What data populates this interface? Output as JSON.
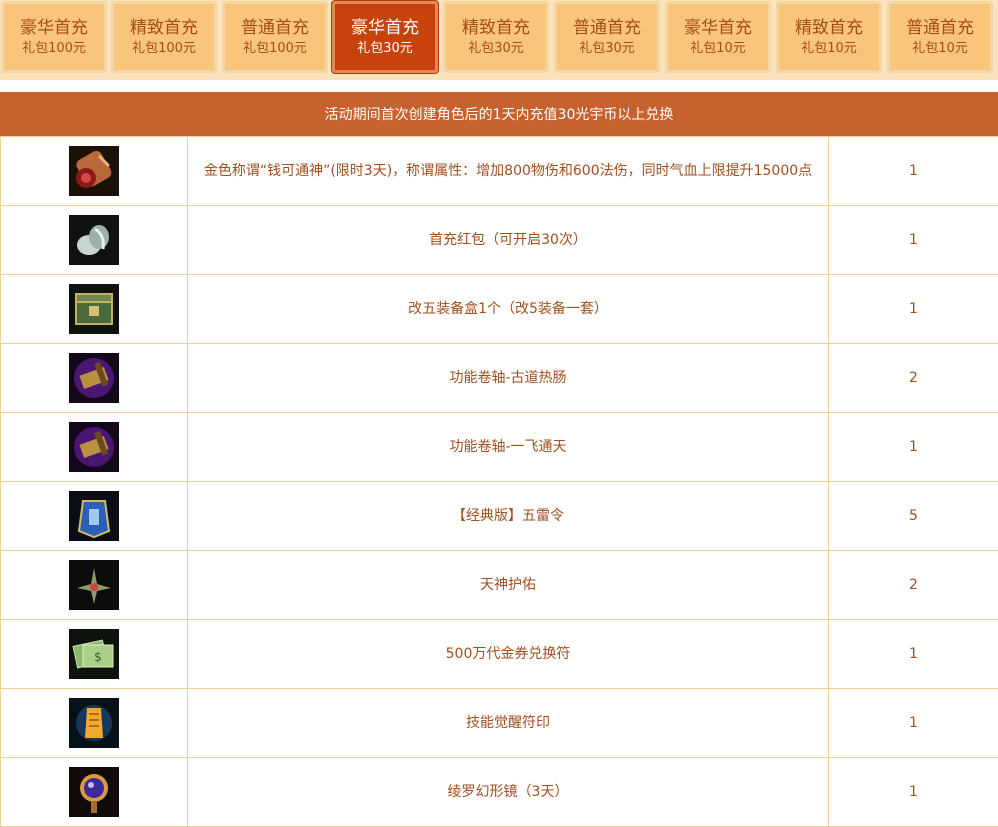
{
  "tabs": [
    {
      "title": "豪华首充",
      "sub": "礼包100元",
      "active": false
    },
    {
      "title": "精致首充",
      "sub": "礼包100元",
      "active": false
    },
    {
      "title": "普通首充",
      "sub": "礼包100元",
      "active": false
    },
    {
      "title": "豪华首充",
      "sub": "礼包30元",
      "active": true
    },
    {
      "title": "精致首充",
      "sub": "礼包30元",
      "active": false
    },
    {
      "title": "普通首充",
      "sub": "礼包30元",
      "active": false
    },
    {
      "title": "豪华首充",
      "sub": "礼包10元",
      "active": false
    },
    {
      "title": "精致首充",
      "sub": "礼包10元",
      "active": false
    },
    {
      "title": "普通首充",
      "sub": "礼包10元",
      "active": false
    }
  ],
  "notice": "活动期间首次创建角色后的1天内充值30光宇币以上兑换",
  "items": [
    {
      "icon": "scroll-title-icon",
      "name": "金色称谓“钱可通神”(限时3天)，称谓属性：增加800物伤和600法伤，同时气血上限提升15000点",
      "qty": "1"
    },
    {
      "icon": "red-envelope-icon",
      "name": "首充红包（可开启30次）",
      "qty": "1"
    },
    {
      "icon": "equipment-box-icon",
      "name": "改五装备盒1个（改5装备一套）",
      "qty": "1"
    },
    {
      "icon": "function-scroll-icon",
      "name": "功能卷轴-古道热肠",
      "qty": "2"
    },
    {
      "icon": "function-scroll-icon",
      "name": "功能卷轴-一飞通天",
      "qty": "1"
    },
    {
      "icon": "thunder-token-icon",
      "name": "【经典版】五雷令",
      "qty": "5"
    },
    {
      "icon": "divine-blessing-icon",
      "name": "天神护佑",
      "qty": "2"
    },
    {
      "icon": "cash-voucher-icon",
      "name": "500万代金券兑换符",
      "qty": "1"
    },
    {
      "icon": "skill-seal-icon",
      "name": "技能觉醒符印",
      "qty": "1"
    },
    {
      "icon": "magic-mirror-icon",
      "name": "绫罗幻形镜（3天）",
      "qty": "1"
    }
  ]
}
